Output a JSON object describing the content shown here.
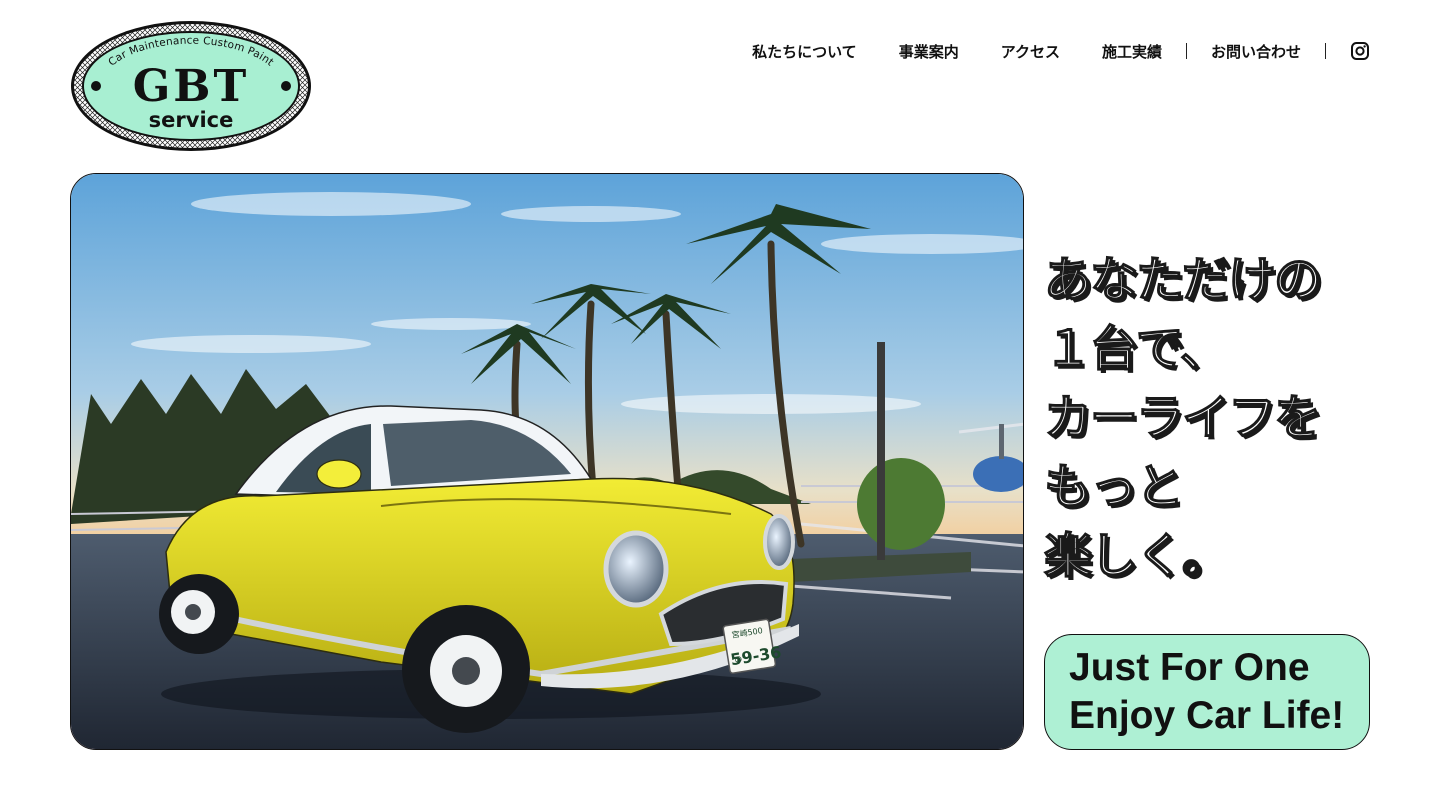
{
  "logo": {
    "arc_text": "Car Maintenance Custom Paint",
    "main_text": "GBT",
    "sub_text": "service",
    "bg_color": "#a8efd2"
  },
  "nav": {
    "items": [
      "私たちについて",
      "事業案内",
      "アクセス",
      "施工実績",
      "お問い合わせ"
    ],
    "instagram_icon": "instagram-icon"
  },
  "hero": {
    "plate_top": "宮崎500",
    "plate_number": "59-36",
    "plate_prefix": "の"
  },
  "catch": {
    "lines": [
      "あなただけの",
      "１台で、",
      "カーライフを",
      "もっと",
      "楽しく。"
    ]
  },
  "cta": {
    "line1": "Just For One",
    "line2": "Enjoy Car Life!",
    "bg_color": "#aef0d4"
  }
}
